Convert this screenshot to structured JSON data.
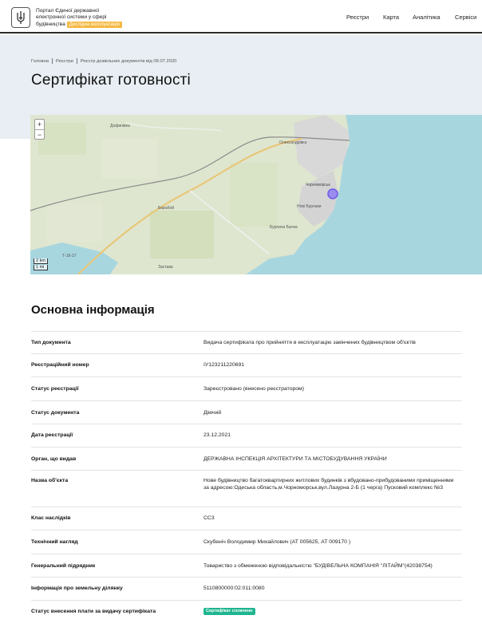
{
  "header": {
    "logo_line1": "Портал Єдиної державної",
    "logo_line2": "електронної системи у сфері",
    "logo_line3": "будівництва",
    "beta_badge": "Дослідна експлуатація",
    "nav": [
      "Реєстри",
      "Карта",
      "Аналітика",
      "Сервіси"
    ]
  },
  "breadcrumb": [
    "Головна",
    "Реєстри",
    "Реєстр дозвільних документів від 08.07.2020"
  ],
  "page_title": "Сертифікат готовності",
  "map": {
    "zoom_in": "+",
    "zoom_out": "−",
    "scale_km": "2 km",
    "scale_mi": "1 mi",
    "labels": [
      "Дофинівка",
      "Олександрівка",
      "Чорноморськ",
      "Нові Бурлаки",
      "Бурлача Балка",
      "Барабой",
      "Застава",
      "Т-16-27"
    ]
  },
  "section_title": "Основна інформація",
  "rows": [
    {
      "label": "Тип документа",
      "value": "Видача сертифіката про прийняття в експлуатацію закінчених будівництвом об'єктів"
    },
    {
      "label": "Реєстраційний номер",
      "value": "ІУ123211220691"
    },
    {
      "label": "Статус реєстрації",
      "value": "Зареєстровано (внесено реєстратором)"
    },
    {
      "label": "Статус документа",
      "value": "Діючий"
    },
    {
      "label": "Дата реєстрації",
      "value": "23.12.2021"
    },
    {
      "label": "Орган, що видав",
      "value": "ДЕРЖАВНА ІНСПЕКЦІЯ АРХІТЕКТУРИ ТА МІСТОБУДУВАННЯ УКРАЇНИ"
    },
    {
      "label": "Назва об'єкта",
      "value": "Нове будівництво багатоквартирних житлових будинків з вбудовано-прибудованими приміщеннями за адресою:Одеська область,м.Чорноморськ,вул.Лазурна 2-Б (1 черга) Пусковий комплекс №3"
    },
    {
      "label": "Клас наслідків",
      "value": "СС3"
    },
    {
      "label": "Технічний нагляд",
      "value": "Скубенiч Володимир Михайлович (АТ 005625, АТ 009170 )"
    },
    {
      "label": "Генеральний підрядник",
      "value": "Товариство з обмеженою відповідальністю \"БУДІВЕЛЬНА КОМПАНІЯ \"ЛІТАЙМ\"(42038754)"
    },
    {
      "label": "Інформація про земельну ділянку",
      "value": "5110800000:02:011:0080"
    },
    {
      "label": "Статус внесення плати за видачу сертифіката",
      "value": "Сертифікат сплачено"
    }
  ]
}
